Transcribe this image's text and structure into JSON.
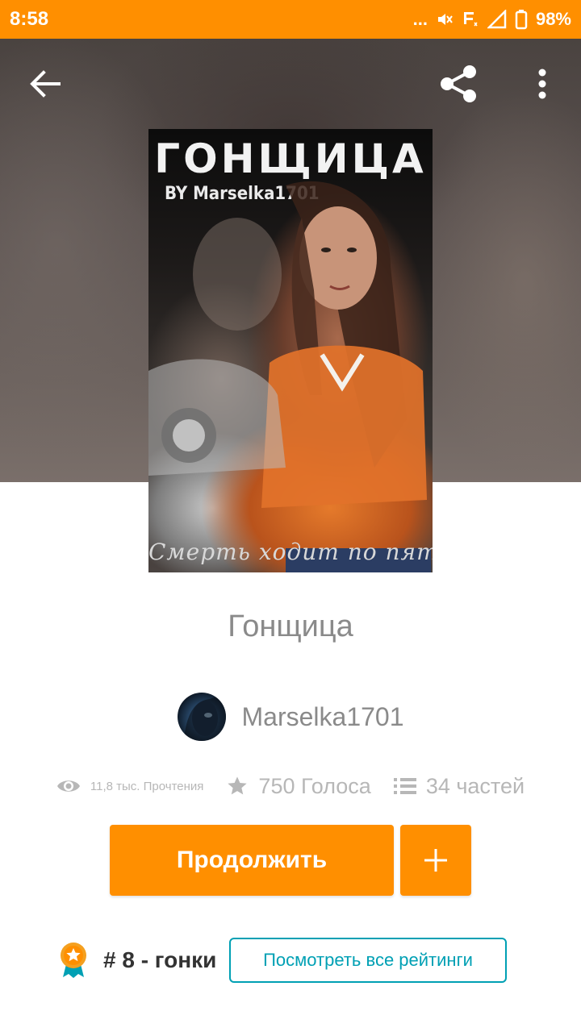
{
  "status_bar": {
    "time": "8:58",
    "dots": "...",
    "battery": "98%",
    "bg_color": "#ff8f00"
  },
  "toolbar": {
    "back_icon": "arrow-left-icon",
    "share_icon": "share-icon",
    "more_icon": "more-vert-icon"
  },
  "cover": {
    "title": "ГОНЩИЦА",
    "author_line": "BY Marselka1701",
    "tagline": "Смерть ходит по пятам"
  },
  "story": {
    "title": "Гонщица",
    "author": "Marselka1701"
  },
  "stats": {
    "reads": "11,8 тыс. Прочтения",
    "votes": "750 Голоса",
    "parts": "34 частей"
  },
  "actions": {
    "continue_label": "Продолжить",
    "add_label": "+",
    "accent_color": "#ff8f00"
  },
  "ranking": {
    "rank_text": "# 8 - гонки",
    "view_all_label": "Посмотреть все рейтинги",
    "link_color": "#00a0b4"
  }
}
